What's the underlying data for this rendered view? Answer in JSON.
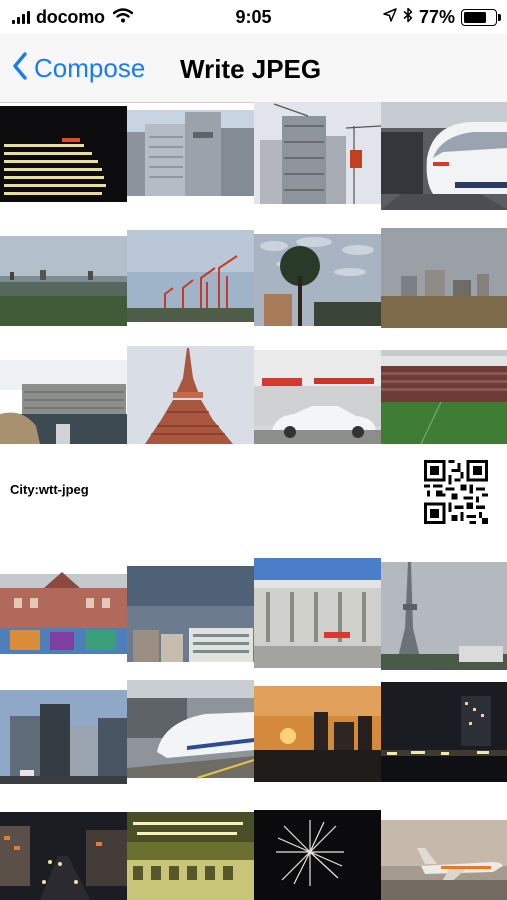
{
  "status_bar": {
    "carrier": "docomo",
    "time": "9:05",
    "battery_percent": "77%",
    "battery_level": 0.77,
    "icons": [
      "signal-icon",
      "wifi-icon",
      "location-arrow-icon",
      "bluetooth-icon",
      "battery-icon"
    ]
  },
  "nav": {
    "back_label": "Compose",
    "title": "Write JPEG",
    "accent": "#1a7cf5"
  },
  "grid": {
    "rows": [
      {
        "kind": "photos",
        "items": [
          {
            "name": "photo-night-building"
          },
          {
            "name": "photo-office-towers"
          },
          {
            "name": "photo-construction-tower"
          },
          {
            "name": "photo-bullet-train-platform"
          }
        ]
      },
      {
        "kind": "photos",
        "items": [
          {
            "name": "photo-bay-skyline"
          },
          {
            "name": "photo-port-cranes"
          },
          {
            "name": "photo-tree-cloudy-sky"
          },
          {
            "name": "photo-city-dusk"
          }
        ]
      },
      {
        "kind": "photos",
        "items": [
          {
            "name": "photo-apartment-canal"
          },
          {
            "name": "photo-tokyo-tower"
          },
          {
            "name": "photo-street-white-car"
          },
          {
            "name": "photo-stadium-field"
          }
        ]
      },
      {
        "kind": "text",
        "label": "City:wtt-jpeg",
        "qr_icon": "qr-code-icon"
      },
      {
        "kind": "photos",
        "items": [
          {
            "name": "photo-colorful-building"
          },
          {
            "name": "photo-low-buildings-sky"
          },
          {
            "name": "photo-stadium-gate"
          },
          {
            "name": "photo-skytree"
          }
        ]
      },
      {
        "kind": "photos",
        "items": [
          {
            "name": "photo-city-street"
          },
          {
            "name": "photo-shinkansen"
          },
          {
            "name": "photo-sunset-skyline"
          },
          {
            "name": "photo-night-city-lights"
          }
        ]
      },
      {
        "kind": "photos",
        "items": [
          {
            "name": "photo-night-street"
          },
          {
            "name": "photo-train-station"
          },
          {
            "name": "photo-fireworks"
          },
          {
            "name": "photo-airplane-runway"
          }
        ]
      }
    ]
  }
}
